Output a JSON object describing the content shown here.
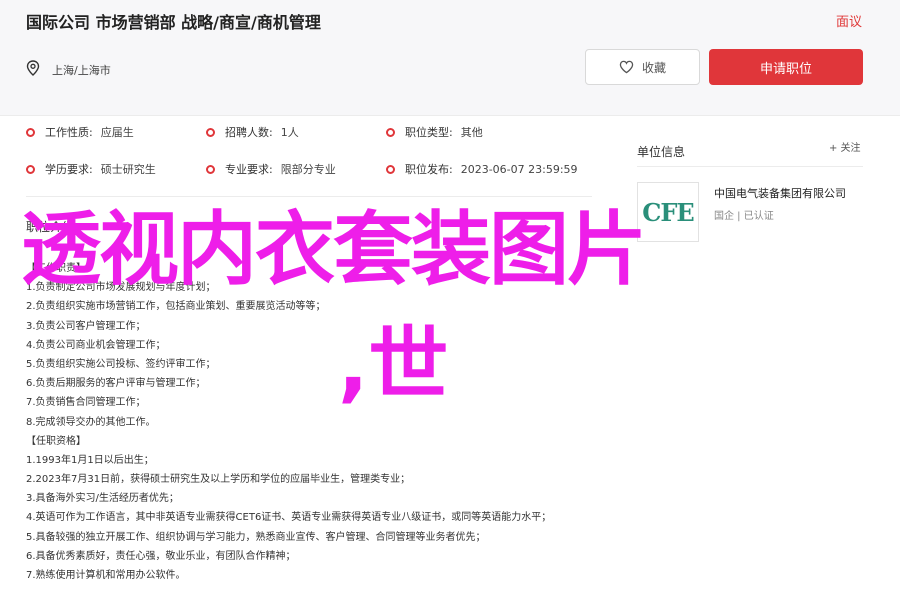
{
  "header": {
    "title": "国际公司 市场营销部 战略/商宣/商机管理",
    "report_label": "面议",
    "location": "上海/上海市",
    "favorite_label": "收藏",
    "apply_label": "申请职位"
  },
  "attributes": [
    {
      "key": "工作性质:",
      "value": "应届生"
    },
    {
      "key": "招聘人数:",
      "value": "1人"
    },
    {
      "key": "职位类型:",
      "value": "其他"
    },
    {
      "key": "学历要求:",
      "value": "硕士研究生"
    },
    {
      "key": "专业要求:",
      "value": "限部分专业"
    },
    {
      "key": "职位发布:",
      "value": "2023-06-07 23:59:59"
    }
  ],
  "description": {
    "section_title": "职位介绍",
    "lines": [
      "【工作职责】",
      "1.负责制定公司市场发展规划与年度计划；",
      "2.负责组织实施市场营销工作，包括商业策划、重要展览活动等等；",
      "3.负责公司客户管理工作；",
      "4.负责公司商业机会管理工作；",
      "5.负责组织实施公司投标、签约评审工作；",
      "6.负责后期服务的客户评审与管理工作；",
      "7.负责销售合同管理工作；",
      "8.完成领导交办的其他工作。",
      "【任职资格】",
      "1.1993年1月1日以后出生；",
      "2.2023年7月31日前，获得硕士研究生及以上学历和学位的应届毕业生，管理类专业；",
      "3.具备海外实习/生活经历者优先；",
      "4.英语可作为工作语言，其中非英语专业需获得CET6证书、英语专业需获得英语专业八级证书，或同等英语能力水平；",
      "5.具备较强的独立开展工作、组织协调与学习能力，熟悉商业宣传、客户管理、合同管理等业务者优先；",
      "6.具备优秀素质好，责任心强，敬业乐业，有团队合作精神；",
      "7.熟练使用计算机和常用办公软件。"
    ]
  },
  "company": {
    "section_title": "单位信息",
    "follow_label": "+ 关注",
    "logo_text": "CFE",
    "name": "中国电气装备集团有限公司",
    "tags": "国企 | 已认证"
  },
  "overlay": {
    "line1": "透视内衣套装图片",
    "line2": ",世"
  },
  "colors": {
    "accent": "#e0363a",
    "overlay": "#ee1ee9",
    "logo": "#2a8f7a"
  }
}
